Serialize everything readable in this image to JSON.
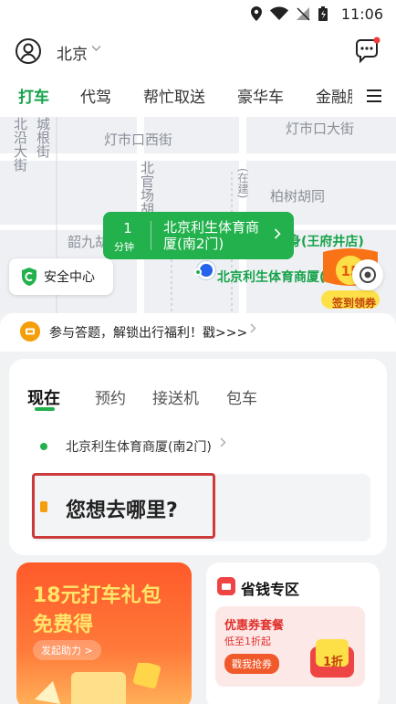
{
  "status_bar": {
    "time": "11:06"
  },
  "header": {
    "city": "北京"
  },
  "service_tabs": [
    "打车",
    "代驾",
    "帮忙取送",
    "豪华车",
    "金融服"
  ],
  "map": {
    "labels": {
      "street_vertical_left": "北沿大街",
      "street_vertical_left2": "城根街",
      "dengshikou_west": "灯市口西街",
      "dengshikou_east": "灯市口大街",
      "beiguan": "北官场胡同",
      "boshu": "柏树胡同",
      "zaijian": "(在建)",
      "jiubao": "韶九胡",
      "wangfujing_poi": "身(王府井店)",
      "current_poi": "北京利生体育商厦(南2门"
    },
    "eta": {
      "minutes": "1",
      "unit": "分钟",
      "place": "北京利生体育商厦(南2门)"
    },
    "safety_center": "安全中心",
    "promo_badge": {
      "label": "签到领券",
      "amount": "15"
    }
  },
  "notice": {
    "text": "参与答题，解锁出行福利！戳>>>"
  },
  "booking": {
    "tabs": [
      "现在",
      "预约",
      "接送机",
      "包车"
    ],
    "origin": "北京利生体育商厦(南2门)",
    "destination_placeholder": "您想去哪里?"
  },
  "promo_left": {
    "title": "18元打车礼包",
    "subtitle": "免费得",
    "button": "发起助力 >"
  },
  "promo_right": {
    "title": "省钱专区",
    "card_title": "优惠券套餐",
    "card_sub": "低至1折起",
    "card_button": "戳我抢券",
    "coupon_text": "1折"
  },
  "colors": {
    "brand_green": "#22b14c",
    "focus_red": "#cc3b3b"
  }
}
